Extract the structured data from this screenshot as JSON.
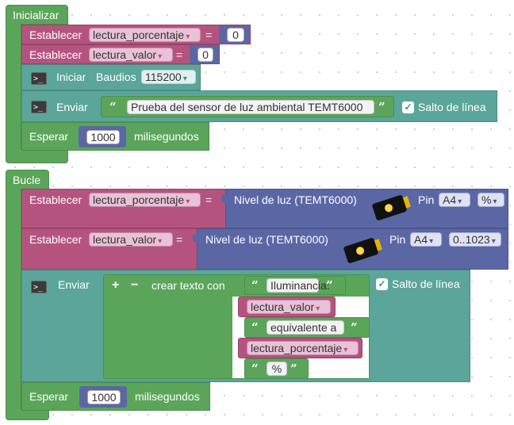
{
  "init": {
    "hat_label": "Inicializar",
    "set_label": "Establecer",
    "var_percent": "lectura_porcentaje",
    "var_value": "lectura_valor",
    "equals": "=",
    "zero": "0",
    "serial_begin_label": "Iniciar",
    "baud_label": "Baudios",
    "baud_value": "115200",
    "send_label": "Enviar",
    "send_text": "Prueba del sensor de luz ambiental TEMT6000",
    "newline_label": "Salto de línea",
    "wait_label": "Esperar",
    "wait_value": "1000",
    "ms_label": "milisegundos"
  },
  "loop": {
    "hat_label": "Bucle",
    "set_label": "Establecer",
    "var_percent": "lectura_porcentaje",
    "var_value": "lectura_valor",
    "equals": "=",
    "sensor_label": "Nivel de luz (TEMT6000)",
    "pin_label": "Pin",
    "pin_value": "A4",
    "mode_percent": "%",
    "mode_range": "0..1023",
    "send_label": "Enviar",
    "plus": "+",
    "minus": "−",
    "create_text_label": "crear texto con",
    "text_items": [
      "Iluminancia:",
      "equivalente a",
      "%"
    ],
    "newline_label": "Salto de línea",
    "wait_label": "Esperar",
    "wait_value": "1000",
    "ms_label": "milisegundos"
  },
  "icons": {
    "dropdown": "▾",
    "quote_open": "“",
    "quote_close": "”",
    "check": "✓",
    "terminal": ">_"
  },
  "colors": {
    "control": "#5ba55b",
    "variable": "#b4547e",
    "serial": "#5ba59a",
    "sensor": "#5b67a5"
  }
}
